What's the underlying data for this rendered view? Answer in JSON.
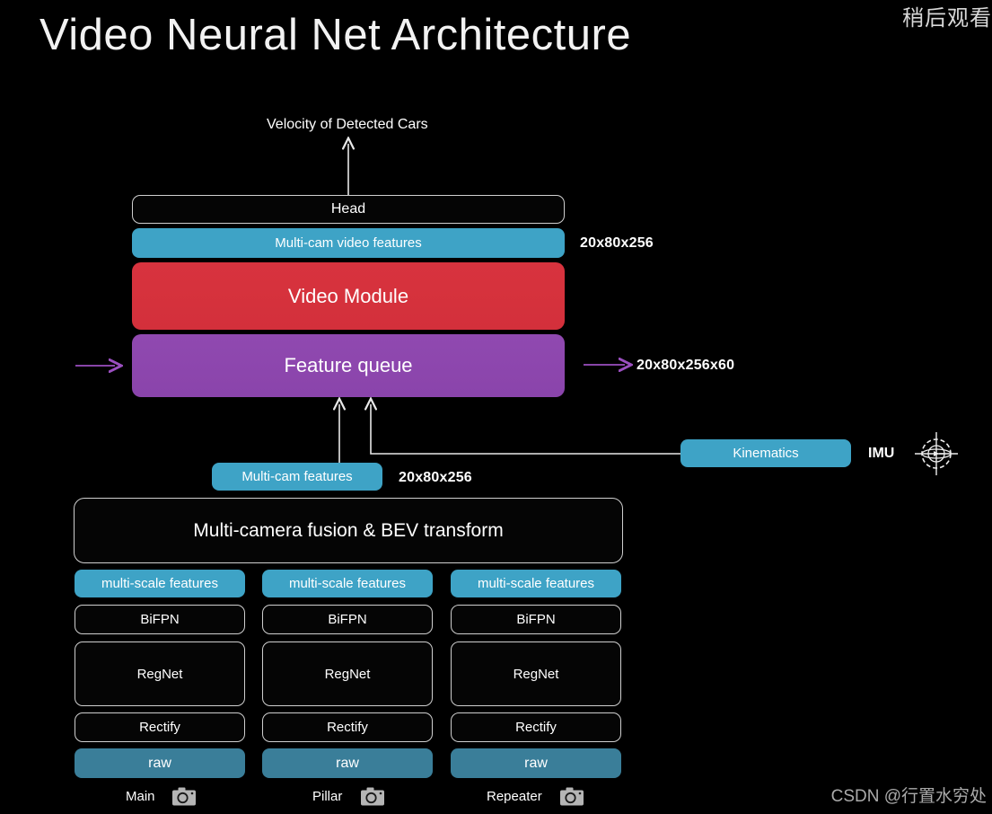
{
  "header": {
    "title": "Video Neural Net Architecture",
    "watch_later": "稍后观看",
    "watermark": "CSDN @行置水穷处"
  },
  "diagram": {
    "output_label": "Velocity of Detected Cars",
    "nodes": {
      "head": "Head",
      "multi_cam_video_features": "Multi-cam video features",
      "video_module": "Video Module",
      "feature_queue": "Feature queue",
      "kinematics": "Kinematics",
      "multi_cam_features": "Multi-cam features",
      "bev_transform": "Multi-camera fusion & BEV transform"
    },
    "dim_labels": {
      "video_features_dim": "20x80x256",
      "feature_queue_dim": "20x80x256x60",
      "multi_cam_features_dim": "20x80x256"
    },
    "imu_label": "IMU",
    "columns": [
      {
        "camera": "Main",
        "stack": [
          "multi-scale features",
          "BiFPN",
          "RegNet",
          "Rectify",
          "raw"
        ]
      },
      {
        "camera": "Pillar",
        "stack": [
          "multi-scale features",
          "BiFPN",
          "RegNet",
          "Rectify",
          "raw"
        ]
      },
      {
        "camera": "Repeater",
        "stack": [
          "multi-scale features",
          "BiFPN",
          "RegNet",
          "Rectify",
          "raw"
        ]
      }
    ],
    "colors": {
      "teal": "#3ea3c6",
      "teal_dark": "#3a7e99",
      "red": "#d8333e",
      "purple": "#8e47ab",
      "outline": "#cfcfcf",
      "background": "#000000",
      "arrow_purple": "#9b4fc0",
      "arrow_white": "#e8e8e8"
    }
  }
}
